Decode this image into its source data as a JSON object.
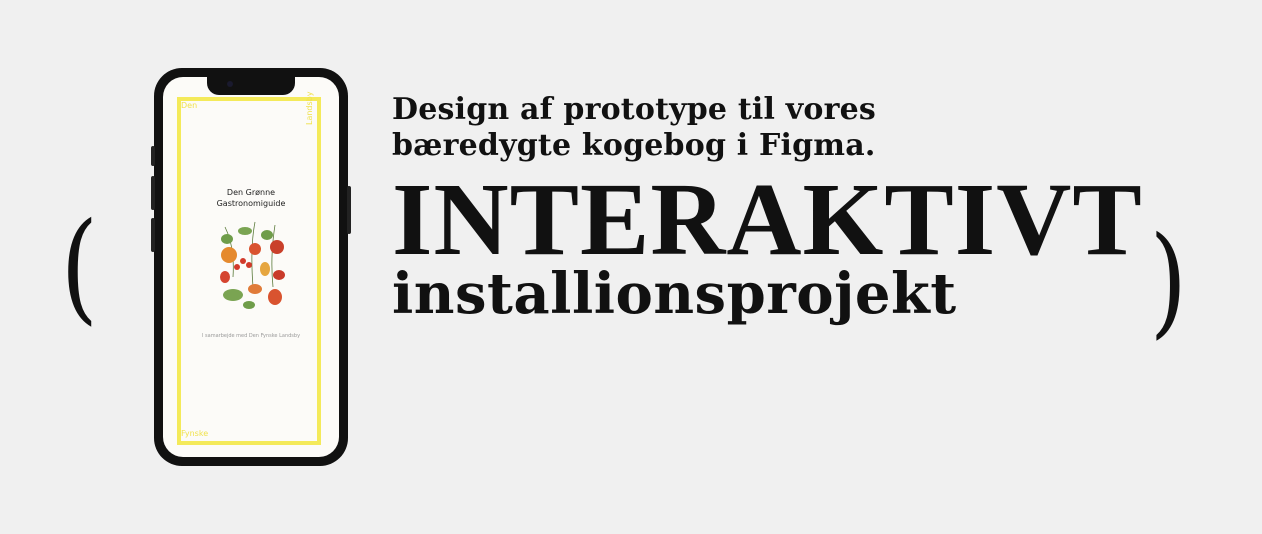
{
  "hero": {
    "paren_left": "(",
    "paren_right": ")",
    "subtitle_line1": "Design af prototype til vores",
    "subtitle_line2": "bæredygte kogebog i Figma.",
    "title": "INTERAKTIVT",
    "title_sub": "installionsprojekt"
  },
  "phone_screen": {
    "corner_top": "Den",
    "corner_side": "Landsby",
    "corner_bottom": "Fynske",
    "book_title_line1": "Den Grønne",
    "book_title_line2": "Gastronomiguide",
    "book_subtitle": "I samarbejde med Den Fynske Landsby",
    "illustration_icon": "vegetables-illustration-icon",
    "frame_color": "#f4ea5a"
  }
}
